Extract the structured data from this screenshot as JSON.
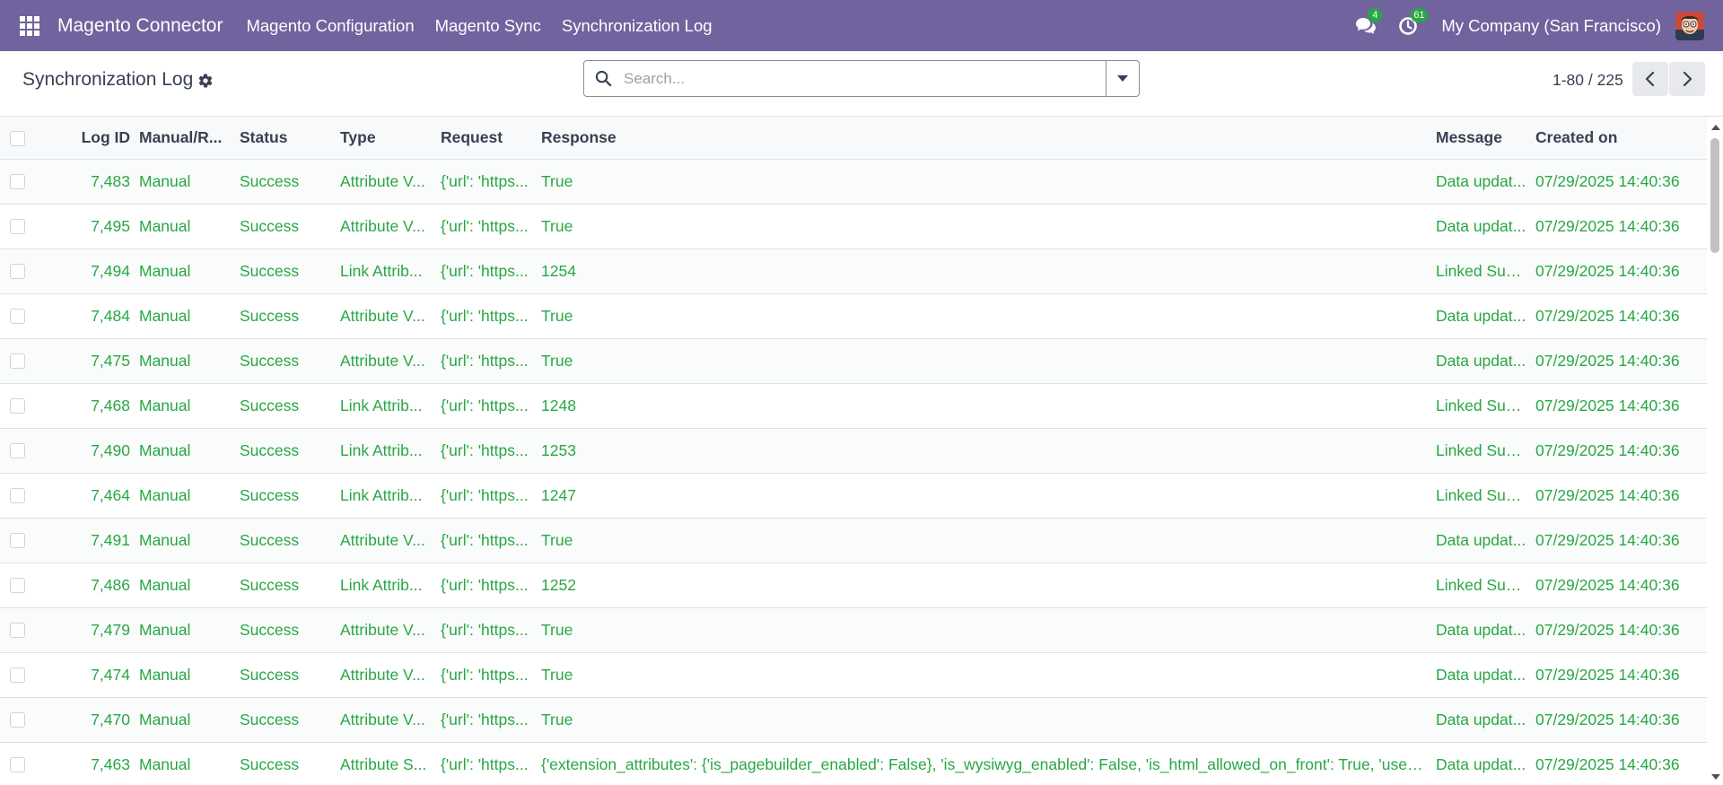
{
  "navbar": {
    "app_name": "Magento Connector",
    "menu": [
      "Magento Configuration",
      "Magento Sync",
      "Synchronization Log"
    ],
    "messages_count": "4",
    "activities_count": "61",
    "company": "My Company (San Francisco)",
    "icons": [
      "apps-grid-icon",
      "chat-icon",
      "clock-icon"
    ]
  },
  "control_panel": {
    "title": "Synchronization Log",
    "search_placeholder": "Search...",
    "pager": "1-80 / 225"
  },
  "table": {
    "columns": [
      "Log ID",
      "Manual/R...",
      "Status",
      "Type",
      "Request",
      "Response",
      "Message",
      "Created on"
    ],
    "rows": [
      {
        "id": "7,483",
        "mode": "Manual",
        "status": "Success",
        "type": "Attribute V...",
        "request": "{'url': 'https...",
        "response": "True",
        "message": "Data updat...",
        "created": "07/29/2025 14:40:36"
      },
      {
        "id": "7,495",
        "mode": "Manual",
        "status": "Success",
        "type": "Attribute V...",
        "request": "{'url': 'https...",
        "response": "True",
        "message": "Data updat...",
        "created": "07/29/2025 14:40:36"
      },
      {
        "id": "7,494",
        "mode": "Manual",
        "status": "Success",
        "type": "Link Attrib...",
        "request": "{'url': 'https...",
        "response": "1254",
        "message": "Linked Suc...",
        "created": "07/29/2025 14:40:36"
      },
      {
        "id": "7,484",
        "mode": "Manual",
        "status": "Success",
        "type": "Attribute V...",
        "request": "{'url': 'https...",
        "response": "True",
        "message": "Data updat...",
        "created": "07/29/2025 14:40:36"
      },
      {
        "id": "7,475",
        "mode": "Manual",
        "status": "Success",
        "type": "Attribute V...",
        "request": "{'url': 'https...",
        "response": "True",
        "message": "Data updat...",
        "created": "07/29/2025 14:40:36"
      },
      {
        "id": "7,468",
        "mode": "Manual",
        "status": "Success",
        "type": "Link Attrib...",
        "request": "{'url': 'https...",
        "response": "1248",
        "message": "Linked Suc...",
        "created": "07/29/2025 14:40:36"
      },
      {
        "id": "7,490",
        "mode": "Manual",
        "status": "Success",
        "type": "Link Attrib...",
        "request": "{'url': 'https...",
        "response": "1253",
        "message": "Linked Suc...",
        "created": "07/29/2025 14:40:36"
      },
      {
        "id": "7,464",
        "mode": "Manual",
        "status": "Success",
        "type": "Link Attrib...",
        "request": "{'url': 'https...",
        "response": "1247",
        "message": "Linked Suc...",
        "created": "07/29/2025 14:40:36"
      },
      {
        "id": "7,491",
        "mode": "Manual",
        "status": "Success",
        "type": "Attribute V...",
        "request": "{'url': 'https...",
        "response": "True",
        "message": "Data updat...",
        "created": "07/29/2025 14:40:36"
      },
      {
        "id": "7,486",
        "mode": "Manual",
        "status": "Success",
        "type": "Link Attrib...",
        "request": "{'url': 'https...",
        "response": "1252",
        "message": "Linked Suc...",
        "created": "07/29/2025 14:40:36"
      },
      {
        "id": "7,479",
        "mode": "Manual",
        "status": "Success",
        "type": "Attribute V...",
        "request": "{'url': 'https...",
        "response": "True",
        "message": "Data updat...",
        "created": "07/29/2025 14:40:36"
      },
      {
        "id": "7,474",
        "mode": "Manual",
        "status": "Success",
        "type": "Attribute V...",
        "request": "{'url': 'https...",
        "response": "True",
        "message": "Data updat...",
        "created": "07/29/2025 14:40:36"
      },
      {
        "id": "7,470",
        "mode": "Manual",
        "status": "Success",
        "type": "Attribute V...",
        "request": "{'url': 'https...",
        "response": "True",
        "message": "Data updat...",
        "created": "07/29/2025 14:40:36"
      },
      {
        "id": "7,463",
        "mode": "Manual",
        "status": "Success",
        "type": "Attribute S...",
        "request": "{'url': 'https...",
        "response": "{'extension_attributes': {'is_pagebuilder_enabled': False}, 'is_wysiwyg_enabled': False, 'is_html_allowed_on_front': True, 'used_f...",
        "message": "Data updat...",
        "created": "07/29/2025 14:40:36"
      }
    ]
  },
  "colors": {
    "navbar": "#71639e",
    "success_text": "#28a745",
    "badge": "#28a745"
  }
}
